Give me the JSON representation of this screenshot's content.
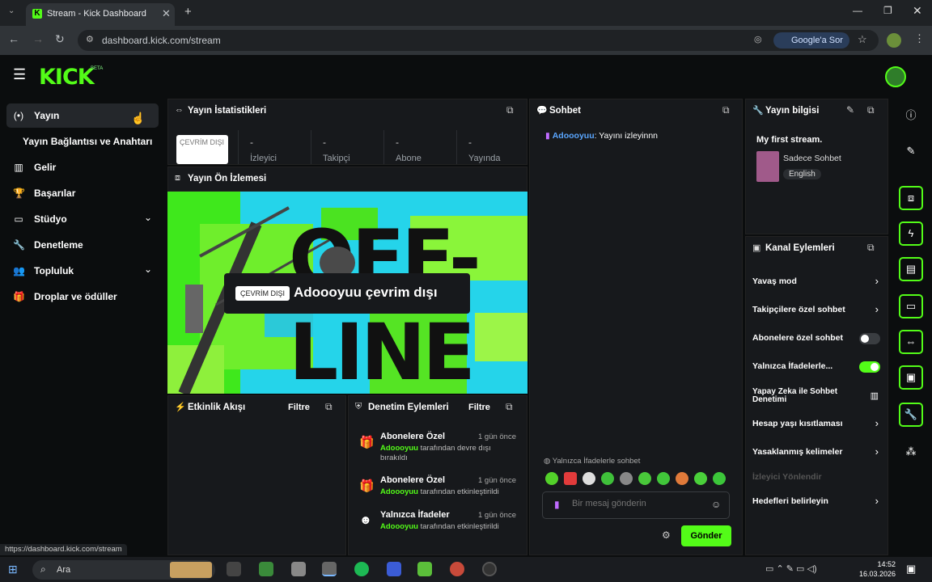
{
  "browser": {
    "tab_title": "Stream - Kick Dashboard",
    "url": "dashboard.kick.com/stream",
    "google_search": "Google'a Sor",
    "status_url": "https://dashboard.kick.com/stream"
  },
  "header": {
    "logo": "KICK",
    "logo_badge": "BETA"
  },
  "sidebar": {
    "items": [
      {
        "label": "Yayın",
        "icon": "broadcast-icon"
      },
      {
        "label": "Yayın Bağlantısı ve Anahtarı"
      },
      {
        "label": "Gelir",
        "icon": "chart-icon"
      },
      {
        "label": "Başarılar",
        "icon": "trophy-icon"
      },
      {
        "label": "Stüdyo",
        "icon": "studio-icon"
      },
      {
        "label": "Denetleme",
        "icon": "wrench-icon"
      },
      {
        "label": "Topluluk",
        "icon": "people-icon"
      },
      {
        "label": "Droplar ve ödüller",
        "icon": "gift-icon"
      }
    ]
  },
  "stats": {
    "title": "Yayın İstatistikleri",
    "offline_badge": "ÇEVRİM DIŞI",
    "cells": [
      {
        "value": "-",
        "label": "İzleyici"
      },
      {
        "value": "-",
        "label": "Takipçi"
      },
      {
        "value": "-",
        "label": "Abone"
      },
      {
        "value": "-",
        "label": "Yayında"
      }
    ]
  },
  "preview": {
    "title": "Yayın Ön İzlemesi",
    "big_text_1": "OFF-",
    "big_text_2": "LINE",
    "offline_pill": "ÇEVRİM DIŞI",
    "offline_message": "Adoooyuu çevrim dışı"
  },
  "activity": {
    "title": "Etkinlik Akışı",
    "filter": "Filtre"
  },
  "mod_actions": {
    "title": "Denetim Eylemleri",
    "filter": "Filtre",
    "items": [
      {
        "title": "Abonelere Özel",
        "time": "1 gün önce",
        "user": "Adoooyuu",
        "desc": " tarafından devre dışı bırakıldı"
      },
      {
        "title": "Abonelere Özel",
        "time": "1 gün önce",
        "user": "Adoooyuu",
        "desc": " tarafından etkinleştirildi"
      },
      {
        "title": "Yalnızca İfadeler",
        "time": "1 gün önce",
        "user": "Adoooyuu",
        "desc": " tarafından etkinleştirildi"
      }
    ]
  },
  "chat": {
    "title": "Sohbet",
    "message_user": "Adoooyuu",
    "message_text": ": Yayını izleyinnn",
    "emote_note": "Yalnızca İfadelerle sohbet",
    "input_placeholder": "Bir mesaj gönderin",
    "send_label": "Gönder"
  },
  "stream_info": {
    "title": "Yayın bilgisi",
    "stream_title": "My first stream.",
    "category": "Sadece Sohbet",
    "language": "English"
  },
  "channel_actions": {
    "title": "Kanal Eylemleri",
    "items": [
      {
        "label": "Yavaş mod",
        "control": "chevron"
      },
      {
        "label": "Takipçilere özel sohbet",
        "control": "chevron"
      },
      {
        "label": "Abonelere özel sohbet",
        "control": "toggle",
        "on": false
      },
      {
        "label": "Yalnızca İfadelerle...",
        "control": "toggle",
        "on": true
      },
      {
        "label": "Yapay Zeka ile Sohbet Denetimi",
        "control": "chart"
      },
      {
        "label": "Hesap yaşı kısıtlaması",
        "control": "chevron"
      },
      {
        "label": "Yasaklanmış kelimeler",
        "control": "chevron"
      },
      {
        "label": "İzleyici Yönlendir",
        "control": "none",
        "disabled": true
      },
      {
        "label": "Hedefleri belirleyin",
        "control": "chevron"
      }
    ]
  },
  "taskbar": {
    "search": "Ara",
    "time": "14:52",
    "date": "16.03.2026"
  },
  "colors": {
    "accent": "#53fc18",
    "panel": "#17191c",
    "bg": "#0b0d0e"
  }
}
